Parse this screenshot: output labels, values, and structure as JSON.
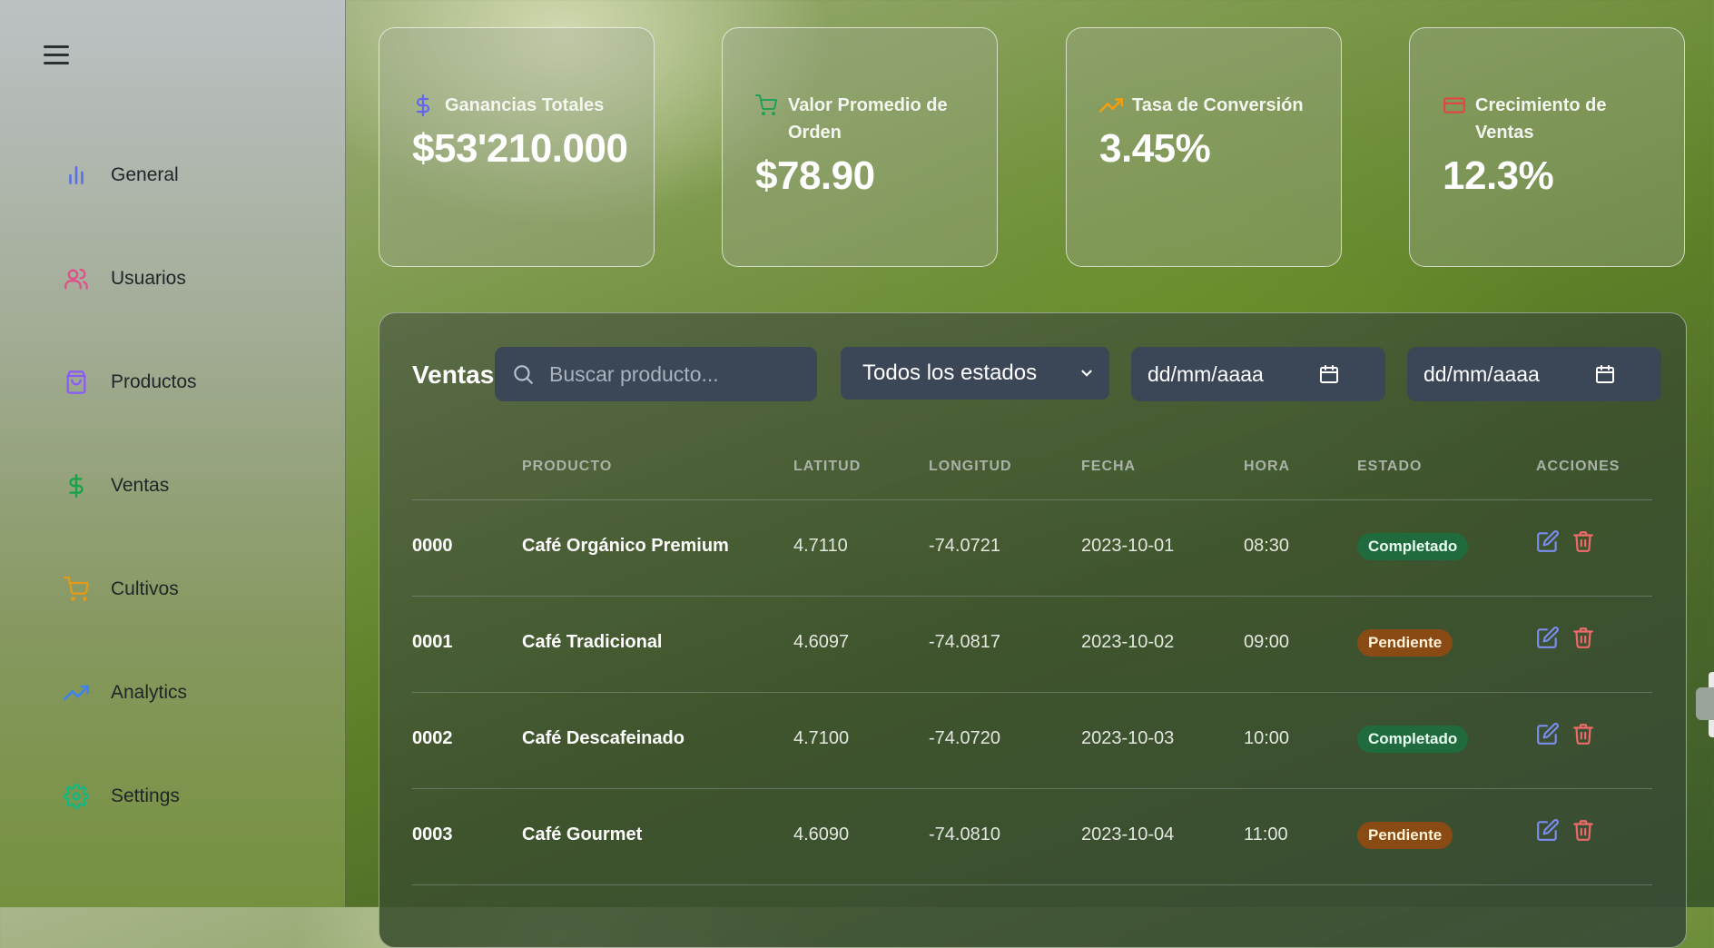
{
  "sidebar": {
    "items": [
      {
        "label": "General",
        "icon": "bar-chart-icon",
        "color": "#5b6ee8"
      },
      {
        "label": "Usuarios",
        "icon": "users-icon",
        "color": "#e0508a"
      },
      {
        "label": "Productos",
        "icon": "shopping-bag-icon",
        "color": "#8b5cf6"
      },
      {
        "label": "Ventas",
        "icon": "dollar-icon",
        "color": "#17a34a"
      },
      {
        "label": "Cultivos",
        "icon": "cart-icon",
        "color": "#e39a16"
      },
      {
        "label": "Analytics",
        "icon": "trending-up-icon",
        "color": "#3b82f6"
      },
      {
        "label": "Settings",
        "icon": "gear-icon",
        "color": "#10b981"
      }
    ]
  },
  "stats": [
    {
      "label": "Ganancias Totales",
      "value": "$53'210.000",
      "icon": "dollar-icon",
      "color": "#6366f1"
    },
    {
      "label": "Valor Promedio de Orden",
      "value": "$78.90",
      "icon": "cart-icon",
      "color": "#22a05a"
    },
    {
      "label": "Tasa de Conversión",
      "value": "3.45%",
      "icon": "trending-up-icon",
      "color": "#f59e0b"
    },
    {
      "label": "Crecimiento de Ventas",
      "value": "12.3%",
      "icon": "card-icon",
      "color": "#e2463f"
    }
  ],
  "sales": {
    "title": "Ventas",
    "search_placeholder": "Buscar producto...",
    "status_filter": "Todos los estados",
    "date_from": "dd/mm/aaaa",
    "date_to": "dd/mm/aaaa",
    "columns": {
      "producto": "PRODUCTO",
      "latitud": "LATITUD",
      "longitud": "LONGITUD",
      "fecha": "FECHA",
      "hora": "HORA",
      "estado": "ESTADO",
      "acciones": "ACCIONES"
    },
    "rows": [
      {
        "id": "0000",
        "producto": "Café Orgánico Premium",
        "latitud": "4.7110",
        "longitud": "-74.0721",
        "fecha": "2023-10-01",
        "hora": "08:30",
        "estado": "Completado",
        "status_type": "ok"
      },
      {
        "id": "0001",
        "producto": "Café Tradicional",
        "latitud": "4.6097",
        "longitud": "-74.0817",
        "fecha": "2023-10-02",
        "hora": "09:00",
        "estado": "Pendiente",
        "status_type": "pend"
      },
      {
        "id": "0002",
        "producto": "Café Descafeinado",
        "latitud": "4.7100",
        "longitud": "-74.0720",
        "fecha": "2023-10-03",
        "hora": "10:00",
        "estado": "Completado",
        "status_type": "ok"
      },
      {
        "id": "0003",
        "producto": "Café Gourmet",
        "latitud": "4.6090",
        "longitud": "-74.0810",
        "fecha": "2023-10-04",
        "hora": "11:00",
        "estado": "Pendiente",
        "status_type": "pend"
      }
    ]
  },
  "colors": {
    "edit": "#7c8cf0",
    "delete": "#ef6a6a"
  }
}
